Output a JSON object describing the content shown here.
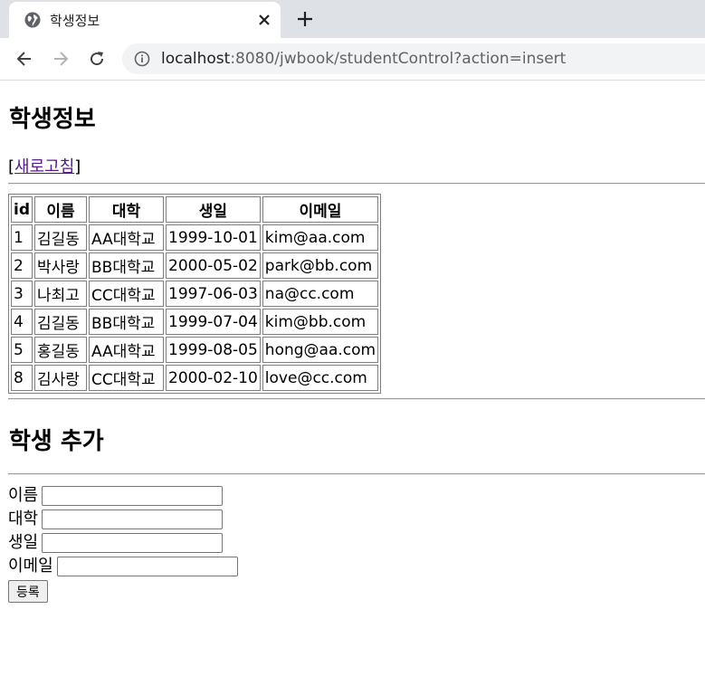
{
  "browser": {
    "tab_title": "학생정보",
    "url_host": "localhost",
    "url_rest": ":8080/jwbook/studentControl?action=insert"
  },
  "page": {
    "title": "학생정보",
    "refresh_open": "[",
    "refresh_link": "새로고침",
    "refresh_close": "]",
    "table": {
      "headers": [
        "id",
        "이름",
        "대학",
        "생일",
        "이메일"
      ],
      "rows": [
        [
          "1",
          "김길동",
          "AA대학교",
          "1999-10-01",
          "kim@aa.com"
        ],
        [
          "2",
          "박사랑",
          "BB대학교",
          "2000-05-02",
          "park@bb.com"
        ],
        [
          "3",
          "나최고",
          "CC대학교",
          "1997-06-03",
          "na@cc.com"
        ],
        [
          "4",
          "김길동",
          "BB대학교",
          "1999-07-04",
          "kim@bb.com"
        ],
        [
          "5",
          "홍길동",
          "AA대학교",
          "1999-08-05",
          "hong@aa.com"
        ],
        [
          "8",
          "김사랑",
          "CC대학교",
          "2000-02-10",
          "love@cc.com"
        ]
      ]
    },
    "add_title": "학생 추가",
    "form": {
      "name_label": "이름",
      "name_value": "",
      "univ_label": "대학",
      "univ_value": "",
      "birth_label": "생일",
      "birth_value": "",
      "email_label": "이메일",
      "email_value": "",
      "submit_label": "등록"
    }
  }
}
